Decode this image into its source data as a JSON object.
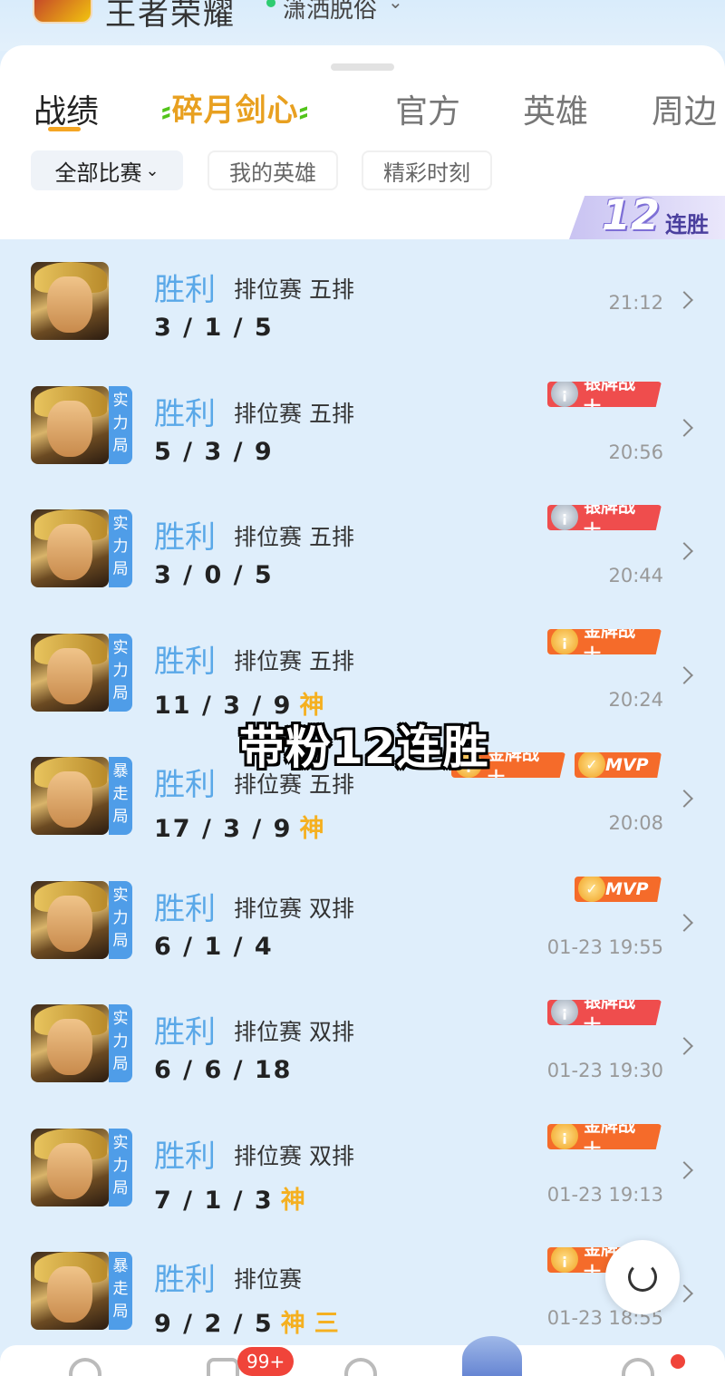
{
  "header": {
    "app_title": "王者荣耀",
    "player_name": "潇洒脱俗"
  },
  "tabs": [
    {
      "label": "战绩"
    },
    {
      "label": "碎月剑心"
    },
    {
      "label": "官方"
    },
    {
      "label": "英雄"
    },
    {
      "label": "周边"
    }
  ],
  "filters": [
    {
      "label": "全部比赛"
    },
    {
      "label": "我的英雄"
    },
    {
      "label": "精彩时刻"
    }
  ],
  "streak": {
    "number": "12",
    "label": "连胜"
  },
  "overlay_caption": "带粉12连胜",
  "nav": {
    "badge_count": "99+"
  },
  "matches": [
    {
      "tag": "",
      "result": "胜利",
      "mode": "排位赛 五排",
      "kda": "3 / 1 / 5",
      "god": "",
      "san": "",
      "badges": [],
      "time": "21:12"
    },
    {
      "tag": "实力局",
      "result": "胜利",
      "mode": "排位赛 五排",
      "kda": "5 / 3 / 9",
      "god": "",
      "san": "",
      "badges": [
        {
          "type": "silver",
          "label": "银牌战士"
        }
      ],
      "time": "20:56"
    },
    {
      "tag": "实力局",
      "result": "胜利",
      "mode": "排位赛 五排",
      "kda": "3 / 0 / 5",
      "god": "",
      "san": "",
      "badges": [
        {
          "type": "silver",
          "label": "银牌战士"
        }
      ],
      "time": "20:44"
    },
    {
      "tag": "实力局",
      "result": "胜利",
      "mode": "排位赛 五排",
      "kda": "11 / 3 / 9",
      "god": "神",
      "san": "",
      "badges": [
        {
          "type": "gold",
          "label": "金牌战士"
        }
      ],
      "time": "20:24"
    },
    {
      "tag": "暴走局",
      "result": "胜利",
      "mode": "排位赛 五排",
      "kda": "17 / 3 / 9",
      "god": "神",
      "san": "",
      "badges": [
        {
          "type": "gold",
          "label": "金牌战士"
        },
        {
          "type": "mvp",
          "label": "MVP"
        }
      ],
      "time": "20:08"
    },
    {
      "tag": "实力局",
      "result": "胜利",
      "mode": "排位赛 双排",
      "kda": "6 / 1 / 4",
      "god": "",
      "san": "",
      "badges": [
        {
          "type": "mvp",
          "label": "MVP"
        }
      ],
      "time": "01-23 19:55"
    },
    {
      "tag": "实力局",
      "result": "胜利",
      "mode": "排位赛 双排",
      "kda": "6 / 6 / 18",
      "god": "",
      "san": "",
      "badges": [
        {
          "type": "silver",
          "label": "银牌战士"
        }
      ],
      "time": "01-23 19:30"
    },
    {
      "tag": "实力局",
      "result": "胜利",
      "mode": "排位赛 双排",
      "kda": "7 / 1 / 3",
      "god": "神",
      "san": "",
      "badges": [
        {
          "type": "gold",
          "label": "金牌战士"
        }
      ],
      "time": "01-23 19:13"
    },
    {
      "tag": "暴走局",
      "result": "胜利",
      "mode": "排位赛",
      "kda": "9 / 2 / 5",
      "god": "神",
      "san": "三",
      "badges": [
        {
          "type": "gold",
          "label": "金牌战士"
        }
      ],
      "time": "01-23 18:55"
    }
  ]
}
